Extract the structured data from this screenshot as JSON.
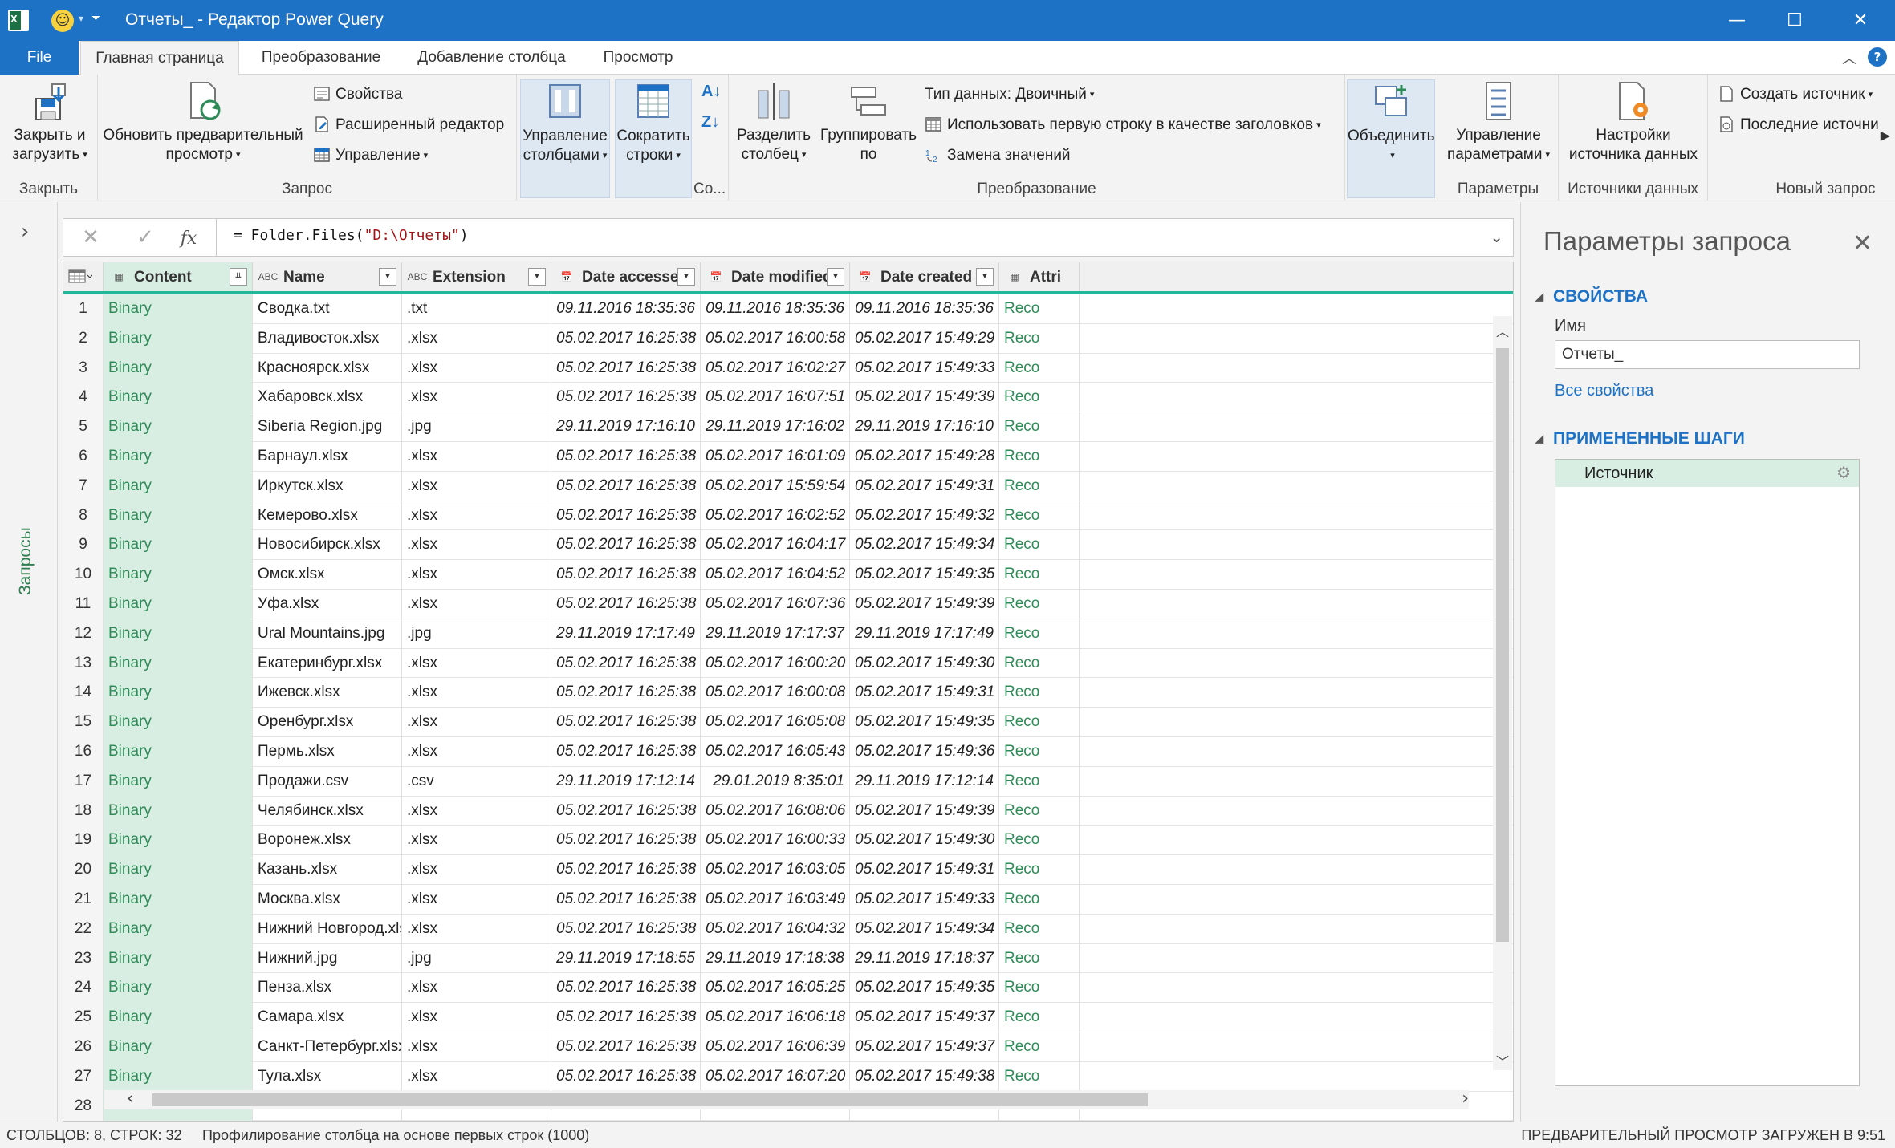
{
  "window": {
    "title": "Отчеты_ - Редактор Power Query",
    "app_icon_letter": "X",
    "colors": {
      "accent": "#1e72c5",
      "selected_column": "#d9eee3",
      "binary_text": "#2e8b57",
      "quality_bar": "#21b89a"
    }
  },
  "tabs": [
    {
      "label": "File"
    },
    {
      "label": "Главная страница"
    },
    {
      "label": "Преобразование"
    },
    {
      "label": "Добавление столбца"
    },
    {
      "label": "Просмотр"
    }
  ],
  "ribbon": {
    "close_group": {
      "label": "Закрыть",
      "close_load": "Закрыть и загрузить"
    },
    "query_group": {
      "label": "Запрос",
      "refresh": "Обновить предварительный просмотр",
      "properties": "Свойства",
      "advanced_editor": "Расширенный редактор",
      "manage": "Управление"
    },
    "columns_group": {
      "manage_columns": "Управление столбцами",
      "reduce_rows": "Сократить строки",
      "sort_label": "Со..."
    },
    "transform_group": {
      "label": "Преобразование",
      "split_column": "Разделить столбец",
      "group_by": "Группировать по",
      "data_type": "Тип данных: Двоичный",
      "first_row_headers": "Использовать первую строку в качестве заголовков",
      "replace_values": "Замена значений"
    },
    "combine_group": {
      "combine": "Объединить"
    },
    "params_group": {
      "label": "Параметры",
      "manage_params": "Управление параметрами"
    },
    "sources_group": {
      "label": "Источники данных",
      "source_settings": "Настройки источника данных"
    },
    "newquery_group": {
      "label": "Новый запрос",
      "new_source": "Создать источник",
      "recent_sources": "Последние источни"
    }
  },
  "left_pane": {
    "label": "Запросы"
  },
  "formula_bar": {
    "prefix": "= Folder.Files(",
    "string": "\"D:\\Отчеты\"",
    "suffix": ")",
    "fx": "fx"
  },
  "grid": {
    "columns": [
      {
        "name": "Content",
        "type_icon": "table"
      },
      {
        "name": "Name",
        "type_icon": "ABC"
      },
      {
        "name": "Extension",
        "type_icon": "ABC"
      },
      {
        "name": "Date accessed",
        "type_icon": "date"
      },
      {
        "name": "Date modified",
        "type_icon": "date"
      },
      {
        "name": "Date created",
        "type_icon": "date"
      },
      {
        "name": "Attri",
        "type_icon": "table"
      }
    ],
    "rows": [
      [
        "1",
        "Binary",
        "Сводка.txt",
        ".txt",
        "09.11.2016 18:35:36",
        "09.11.2016 18:35:36",
        "09.11.2016 18:35:36",
        "Reco"
      ],
      [
        "2",
        "Binary",
        "Владивосток.xlsx",
        ".xlsx",
        "05.02.2017 16:25:38",
        "05.02.2017 16:00:58",
        "05.02.2017 15:49:29",
        "Reco"
      ],
      [
        "3",
        "Binary",
        "Красноярск.xlsx",
        ".xlsx",
        "05.02.2017 16:25:38",
        "05.02.2017 16:02:27",
        "05.02.2017 15:49:33",
        "Reco"
      ],
      [
        "4",
        "Binary",
        "Хабаровск.xlsx",
        ".xlsx",
        "05.02.2017 16:25:38",
        "05.02.2017 16:07:51",
        "05.02.2017 15:49:39",
        "Reco"
      ],
      [
        "5",
        "Binary",
        "Siberia Region.jpg",
        ".jpg",
        "29.11.2019 17:16:10",
        "29.11.2019 17:16:02",
        "29.11.2019 17:16:10",
        "Reco"
      ],
      [
        "6",
        "Binary",
        "Барнаул.xlsx",
        ".xlsx",
        "05.02.2017 16:25:38",
        "05.02.2017 16:01:09",
        "05.02.2017 15:49:28",
        "Reco"
      ],
      [
        "7",
        "Binary",
        "Иркутск.xlsx",
        ".xlsx",
        "05.02.2017 16:25:38",
        "05.02.2017 15:59:54",
        "05.02.2017 15:49:31",
        "Reco"
      ],
      [
        "8",
        "Binary",
        "Кемерово.xlsx",
        ".xlsx",
        "05.02.2017 16:25:38",
        "05.02.2017 16:02:52",
        "05.02.2017 15:49:32",
        "Reco"
      ],
      [
        "9",
        "Binary",
        "Новосибирск.xlsx",
        ".xlsx",
        "05.02.2017 16:25:38",
        "05.02.2017 16:04:17",
        "05.02.2017 15:49:34",
        "Reco"
      ],
      [
        "10",
        "Binary",
        "Омск.xlsx",
        ".xlsx",
        "05.02.2017 16:25:38",
        "05.02.2017 16:04:52",
        "05.02.2017 15:49:35",
        "Reco"
      ],
      [
        "11",
        "Binary",
        "Уфа.xlsx",
        ".xlsx",
        "05.02.2017 16:25:38",
        "05.02.2017 16:07:36",
        "05.02.2017 15:49:39",
        "Reco"
      ],
      [
        "12",
        "Binary",
        "Ural Mountains.jpg",
        ".jpg",
        "29.11.2019 17:17:49",
        "29.11.2019 17:17:37",
        "29.11.2019 17:17:49",
        "Reco"
      ],
      [
        "13",
        "Binary",
        "Екатеринбург.xlsx",
        ".xlsx",
        "05.02.2017 16:25:38",
        "05.02.2017 16:00:20",
        "05.02.2017 15:49:30",
        "Reco"
      ],
      [
        "14",
        "Binary",
        "Ижевск.xlsx",
        ".xlsx",
        "05.02.2017 16:25:38",
        "05.02.2017 16:00:08",
        "05.02.2017 15:49:31",
        "Reco"
      ],
      [
        "15",
        "Binary",
        "Оренбург.xlsx",
        ".xlsx",
        "05.02.2017 16:25:38",
        "05.02.2017 16:05:08",
        "05.02.2017 15:49:35",
        "Reco"
      ],
      [
        "16",
        "Binary",
        "Пермь.xlsx",
        ".xlsx",
        "05.02.2017 16:25:38",
        "05.02.2017 16:05:43",
        "05.02.2017 15:49:36",
        "Reco"
      ],
      [
        "17",
        "Binary",
        "Продажи.csv",
        ".csv",
        "29.11.2019 17:12:14",
        "29.01.2019 8:35:01",
        "29.11.2019 17:12:14",
        "Reco"
      ],
      [
        "18",
        "Binary",
        "Челябинск.xlsx",
        ".xlsx",
        "05.02.2017 16:25:38",
        "05.02.2017 16:08:06",
        "05.02.2017 15:49:39",
        "Reco"
      ],
      [
        "19",
        "Binary",
        "Воронеж.xlsx",
        ".xlsx",
        "05.02.2017 16:25:38",
        "05.02.2017 16:00:33",
        "05.02.2017 15:49:30",
        "Reco"
      ],
      [
        "20",
        "Binary",
        "Казань.xlsx",
        ".xlsx",
        "05.02.2017 16:25:38",
        "05.02.2017 16:03:05",
        "05.02.2017 15:49:31",
        "Reco"
      ],
      [
        "21",
        "Binary",
        "Москва.xlsx",
        ".xlsx",
        "05.02.2017 16:25:38",
        "05.02.2017 16:03:49",
        "05.02.2017 15:49:33",
        "Reco"
      ],
      [
        "22",
        "Binary",
        "Нижний Новгород.xlsx",
        ".xlsx",
        "05.02.2017 16:25:38",
        "05.02.2017 16:04:32",
        "05.02.2017 15:49:34",
        "Reco"
      ],
      [
        "23",
        "Binary",
        "Нижний.jpg",
        ".jpg",
        "29.11.2019 17:18:55",
        "29.11.2019 17:18:38",
        "29.11.2019 17:18:37",
        "Reco"
      ],
      [
        "24",
        "Binary",
        "Пенза.xlsx",
        ".xlsx",
        "05.02.2017 16:25:38",
        "05.02.2017 16:05:25",
        "05.02.2017 15:49:35",
        "Reco"
      ],
      [
        "25",
        "Binary",
        "Самара.xlsx",
        ".xlsx",
        "05.02.2017 16:25:38",
        "05.02.2017 16:06:18",
        "05.02.2017 15:49:37",
        "Reco"
      ],
      [
        "26",
        "Binary",
        "Санкт-Петербург.xlsx",
        ".xlsx",
        "05.02.2017 16:25:38",
        "05.02.2017 16:06:39",
        "05.02.2017 15:49:37",
        "Reco"
      ],
      [
        "27",
        "Binary",
        "Тула.xlsx",
        ".xlsx",
        "05.02.2017 16:25:38",
        "05.02.2017 16:07:20",
        "05.02.2017 15:49:38",
        "Reco"
      ],
      [
        "28",
        "",
        "",
        "",
        "",
        "",
        "",
        ""
      ]
    ]
  },
  "query_settings": {
    "title": "Параметры запроса",
    "properties_header": "СВОЙСТВА",
    "name_label": "Имя",
    "name_value": "Отчеты_",
    "all_properties_link": "Все свойства",
    "applied_steps_header": "ПРИМЕНЕННЫЕ ШАГИ",
    "steps": [
      {
        "label": "Источник"
      }
    ]
  },
  "status_bar": {
    "counts": "СТОЛБЦОВ: 8, СТРОК: 32",
    "profiling": "Профилирование столбца на основе первых строк (1000)",
    "preview": "ПРЕДВАРИТЕЛЬНЫЙ ПРОСМОТР ЗАГРУЖЕН В 9:51"
  }
}
